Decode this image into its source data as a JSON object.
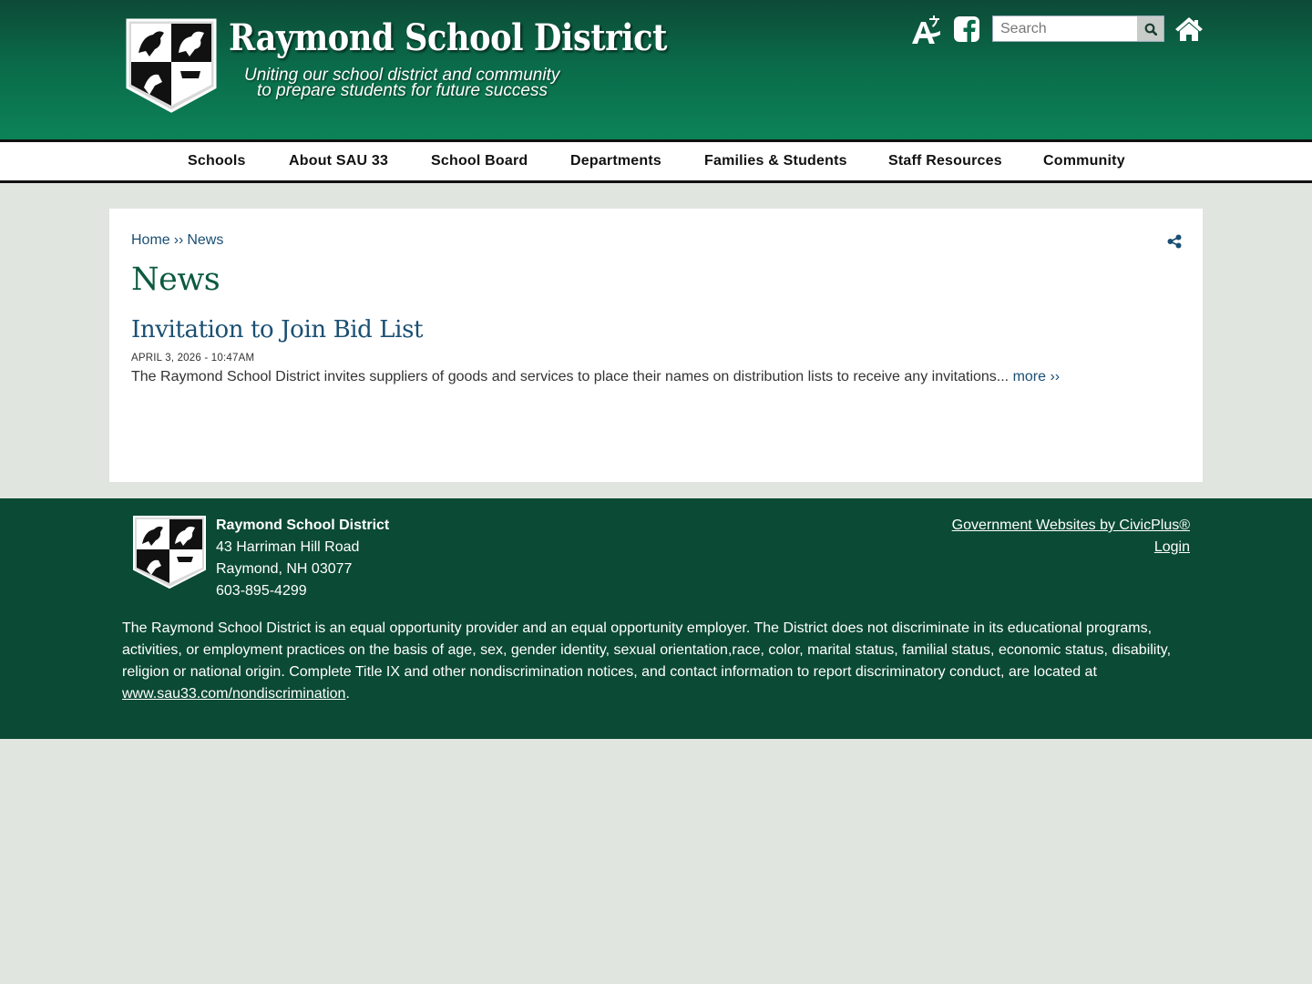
{
  "header": {
    "title": "Raymond School District",
    "tagline_line1": "Uniting our school district and community",
    "tagline_line2": "to prepare students for future success",
    "logo_icon": "district-crest-logo",
    "translate_icon": "translate-icon",
    "facebook_icon": "facebook-icon",
    "home_icon": "home-icon",
    "search": {
      "placeholder": "Search",
      "value": ""
    }
  },
  "nav": {
    "items": [
      {
        "label": "Schools"
      },
      {
        "label": "About SAU 33"
      },
      {
        "label": "School Board"
      },
      {
        "label": "Departments"
      },
      {
        "label": "Families & Students"
      },
      {
        "label": "Staff Resources"
      },
      {
        "label": "Community"
      }
    ]
  },
  "content": {
    "breadcrumb": {
      "home": "Home",
      "separator": "››",
      "current": "News"
    },
    "page_title": "News",
    "news": [
      {
        "title": "Invitation to Join Bid List",
        "date": "APRIL 3, 2026 - 10:47AM",
        "summary": "The Raymond School District invites suppliers of goods and services to place their names on distribution lists to receive any invitations...",
        "more_label": "more ››"
      }
    ]
  },
  "footer": {
    "name": "Raymond School District",
    "address_line1": "43 Harriman Hill Road",
    "address_line2": "Raymond, NH 03077",
    "phone": "603-895-4299",
    "link_civicplus": "Government Websites by CivicPlus®",
    "link_login": "Login",
    "notice_text": "The Raymond School District is an equal opportunity provider and an equal opportunity employer. The District does not discriminate in its educational programs, activities, or employment practices on the basis of age, sex, gender identity, sexual orientation,race, color, marital status, familial status, economic status, disability, religion or national origin. Complete Title IX and other nondiscrimination notices, and contact information to report discriminatory conduct, are located at ",
    "notice_link": "www.sau33.com/nondiscrimination",
    "notice_end": "."
  },
  "colors": {
    "header_green": "#0a6a49",
    "footer_green": "#0b4a35",
    "title_green": "#0c5a3e",
    "link_blue": "#1a4f73",
    "page_background": "#e1e5e0"
  }
}
